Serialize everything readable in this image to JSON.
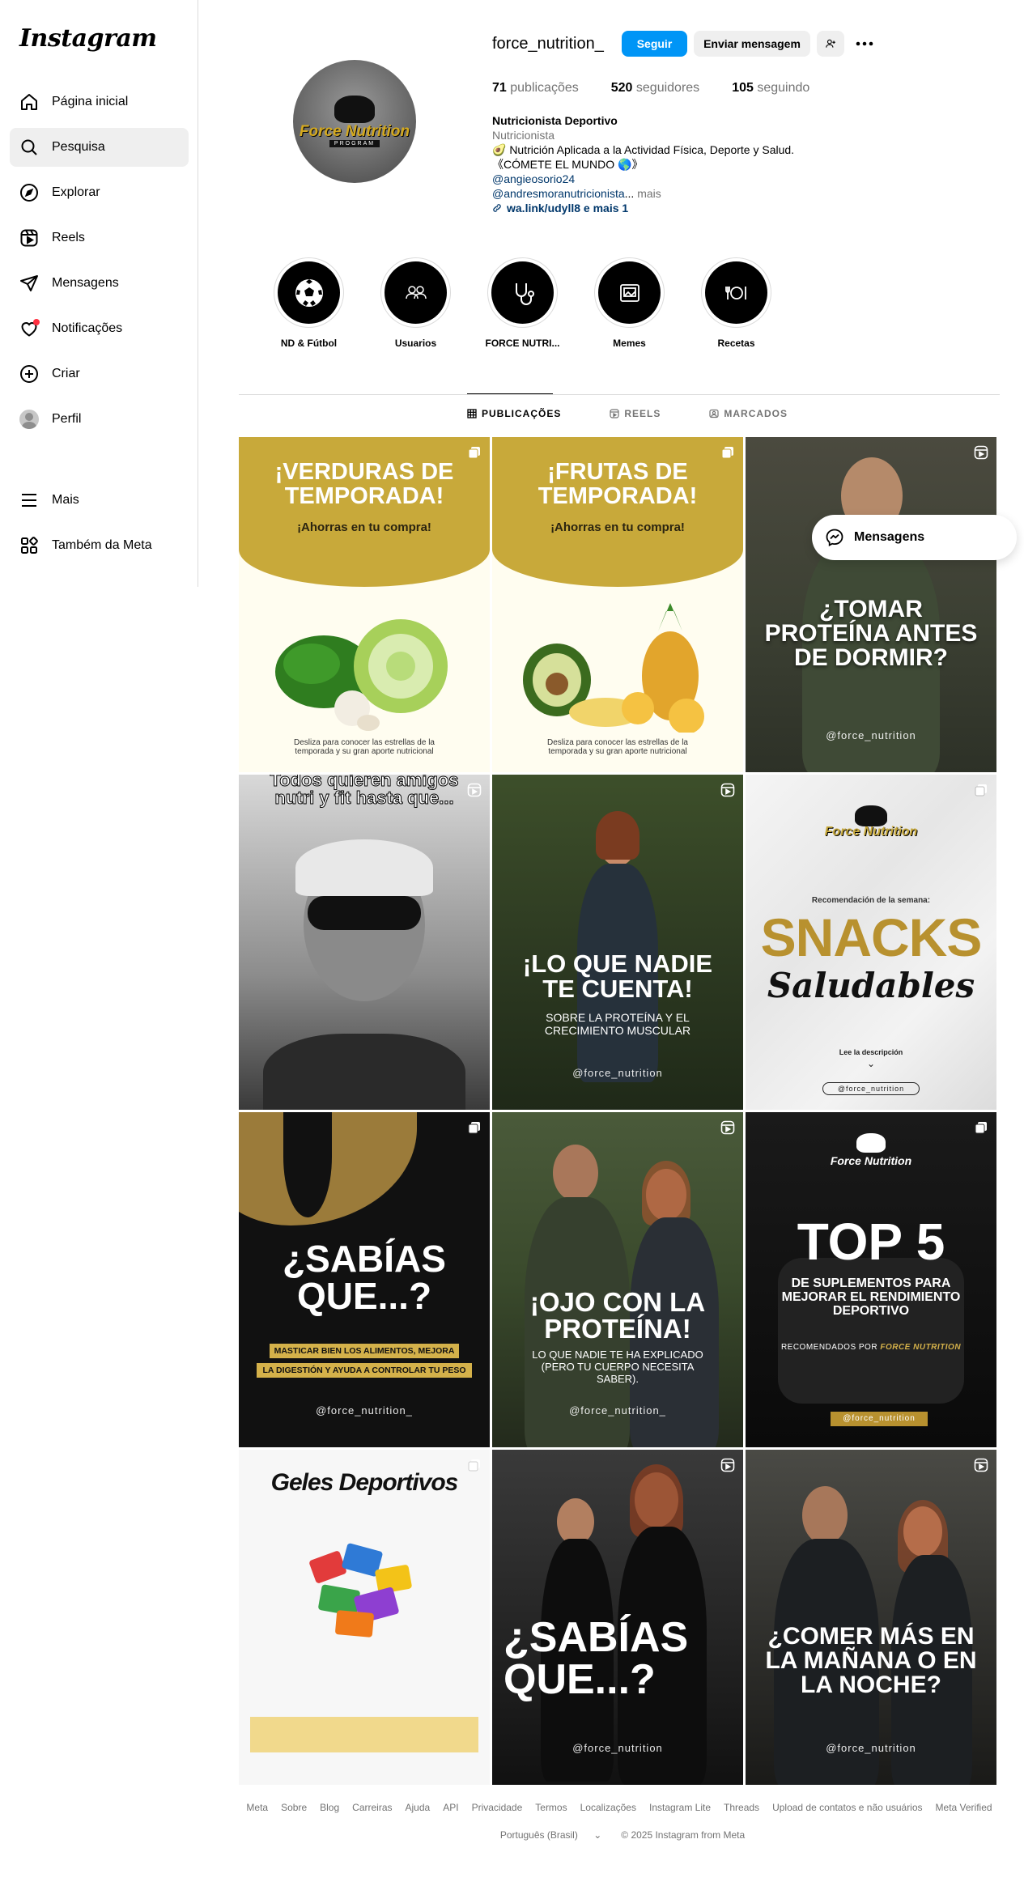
{
  "app": {
    "logo": "Instagram"
  },
  "sidebar": {
    "items": [
      {
        "label": "Página inicial",
        "icon": "home-icon"
      },
      {
        "label": "Pesquisa",
        "icon": "search-icon",
        "active": true
      },
      {
        "label": "Explorar",
        "icon": "compass-icon"
      },
      {
        "label": "Reels",
        "icon": "reels-icon"
      },
      {
        "label": "Mensagens",
        "icon": "send-icon"
      },
      {
        "label": "Notificações",
        "icon": "heart-icon"
      },
      {
        "label": "Criar",
        "icon": "plus-square-icon"
      },
      {
        "label": "Perfil",
        "icon": "avatar"
      }
    ],
    "bottom": [
      {
        "label": "Mais",
        "icon": "menu-icon"
      },
      {
        "label": "Também da Meta",
        "icon": "meta-icon"
      }
    ]
  },
  "profile": {
    "username": "force_nutrition_",
    "follow_label": "Seguir",
    "message_label": "Enviar mensagem",
    "avatar_brand": "Force Nutrition",
    "avatar_program": "PROGRAM",
    "stats": {
      "posts_count": "71",
      "posts_label": "publicações",
      "followers_count": "520",
      "followers_label": "seguidores",
      "following_count": "105",
      "following_label": "seguindo"
    },
    "bio": {
      "name": "Nutricionista Deportivo",
      "category": "Nutricionista",
      "line1": "🥑 Nutrición Aplicada a la Actividad Física, Deporte y Salud.",
      "line2": "《CÓMETE EL MUNDO 🌎》",
      "mention1": "@angieosorio24",
      "mention2": "@andresmoranutricionista",
      "ellipsis": "...",
      "more": "mais",
      "link": "wa.link/udyll8 e mais 1"
    }
  },
  "highlights": [
    {
      "label": "ND & Fútbol",
      "icon": "soccer-ball-icon"
    },
    {
      "label": "Usuarios",
      "icon": "users-icon"
    },
    {
      "label": "FORCE NUTRI...",
      "icon": "stethoscope-icon"
    },
    {
      "label": "Memes",
      "icon": "image-icon"
    },
    {
      "label": "Recetas",
      "icon": "plate-icon"
    }
  ],
  "tabs": [
    {
      "label": "PUBLICAÇÕES",
      "icon": "grid-icon",
      "active": true
    },
    {
      "label": "REELS",
      "icon": "reels-icon"
    },
    {
      "label": "MARCADOS",
      "icon": "tag-icon"
    }
  ],
  "posts": {
    "p1": {
      "title": "¡VERDURAS DE TEMPORADA!",
      "subtitle": "¡Ahorras en tu compra!",
      "caption": "Desliza para conocer las estrellas de la temporada y su gran aporte nutricional"
    },
    "p2": {
      "title": "¡FRUTAS DE TEMPORADA!",
      "subtitle": "¡Ahorras en tu compra!",
      "caption": "Desliza para conocer las estrellas de la temporada y su gran aporte nutricional"
    },
    "p3": {
      "title": "¿TOMAR PROTEÍNA ANTES DE DORMIR?",
      "handle": "@force_nutrition"
    },
    "p4": {
      "title": "Todos quieren amigos nutri y fit hasta que..."
    },
    "p5": {
      "title": "¡LO QUE NADIE TE CUENTA!",
      "subtitle": "SOBRE LA PROTEÍNA Y EL CRECIMIENTO MUSCULAR",
      "handle": "@force_nutrition"
    },
    "p6": {
      "brand": "Force Nutrition",
      "kicker": "Recomendación de la semana:",
      "title": "SNACKS",
      "script": "Saludables",
      "cta": "Lee la descripción",
      "handle": "@force_nutrition"
    },
    "p7": {
      "title": "¿SABÍAS QUE...?",
      "line1": "MASTICAR BIEN LOS ALIMENTOS, MEJORA",
      "line2": "LA DIGESTIÓN Y AYUDA A CONTROLAR TU PESO",
      "handle": "@force_nutrition_"
    },
    "p8": {
      "title": "¡OJO CON LA PROTEÍNA!",
      "subtitle": "LO QUE NADIE TE HA EXPLICADO (PERO TU CUERPO NECESITA SABER).",
      "handle": "@force_nutrition_"
    },
    "p9": {
      "brand": "Force Nutrition",
      "title": "TOP 5",
      "subtitle": "DE SUPLEMENTOS PARA MEJORAR EL RENDIMIENTO DEPORTIVO",
      "note_prefix": "RECOMENDADOS POR",
      "note_brand": "FORCE NUTRITION",
      "handle": "@force_nutrition"
    },
    "p10": {
      "title": "Geles Deportivos"
    },
    "p11": {
      "title": "¿SABÍAS QUE...?",
      "handle": "@force_nutrition"
    },
    "p12": {
      "title": "¿COMER MÁS EN LA MAÑANA O EN LA NOCHE?",
      "handle": "@force_nutrition"
    }
  },
  "messages_pill": {
    "label": "Mensagens"
  },
  "footer": {
    "links": [
      "Meta",
      "Sobre",
      "Blog",
      "Carreiras",
      "Ajuda",
      "API",
      "Privacidade",
      "Termos",
      "Localizações",
      "Instagram Lite",
      "Threads",
      "Upload de contatos e não usuários",
      "Meta Verified"
    ],
    "language": "Português (Brasil)",
    "copyright": "© 2025 Instagram from Meta"
  },
  "colors": {
    "accent": "#0095f6",
    "gold": "#c8a93a",
    "notification": "#ff3040"
  }
}
